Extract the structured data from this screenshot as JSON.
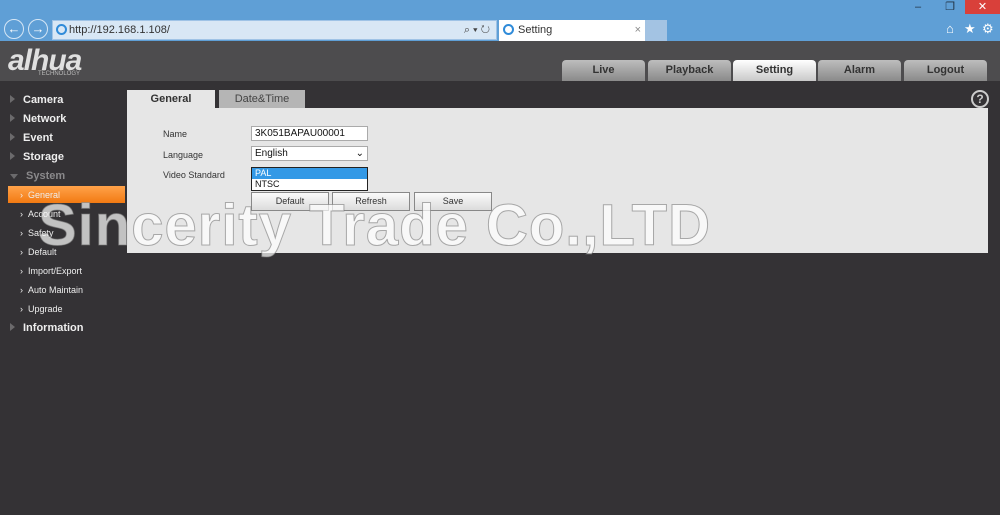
{
  "browser": {
    "url": "http://192.168.1.108/",
    "tab_title": "Setting",
    "minimize": "–",
    "restore": "❐",
    "close": "✕",
    "home": "⌂",
    "favorites": "★",
    "tools": "⚙",
    "back": "←",
    "forward": "→",
    "search_refresh": "⌕ ▾ ↻",
    "tab_close": "×"
  },
  "header": {
    "logo": "alhua",
    "logo_sub": "TECHNOLOGY",
    "tabs": [
      {
        "label": "Live"
      },
      {
        "label": "Playback"
      },
      {
        "label": "Setting"
      },
      {
        "label": "Alarm"
      },
      {
        "label": "Logout"
      }
    ],
    "active_tab": "Setting"
  },
  "sidebar": {
    "items": [
      {
        "label": "Camera"
      },
      {
        "label": "Network"
      },
      {
        "label": "Event"
      },
      {
        "label": "Storage"
      },
      {
        "label": "System"
      },
      {
        "label": "Information"
      }
    ],
    "system_sub": [
      {
        "label": "General"
      },
      {
        "label": "Account"
      },
      {
        "label": "Safety"
      },
      {
        "label": "Default"
      },
      {
        "label": "Import/Export"
      },
      {
        "label": "Auto Maintain"
      },
      {
        "label": "Upgrade"
      }
    ]
  },
  "panel": {
    "tabs": [
      {
        "label": "General"
      },
      {
        "label": "Date&Time"
      }
    ],
    "name_label": "Name",
    "name_value": "3K051BAPAU00001",
    "language_label": "Language",
    "language_value": "English",
    "video_label": "Video Standard",
    "video_options": [
      "PAL",
      "NTSC"
    ],
    "video_selected": "PAL",
    "buttons": {
      "default": "Default",
      "refresh": "Refresh",
      "save": "Save"
    },
    "help": "?"
  },
  "watermark": "Sincerity Trade Co.,LTD",
  "colors": {
    "accent": "#f5841f",
    "selection": "#3399e6"
  }
}
